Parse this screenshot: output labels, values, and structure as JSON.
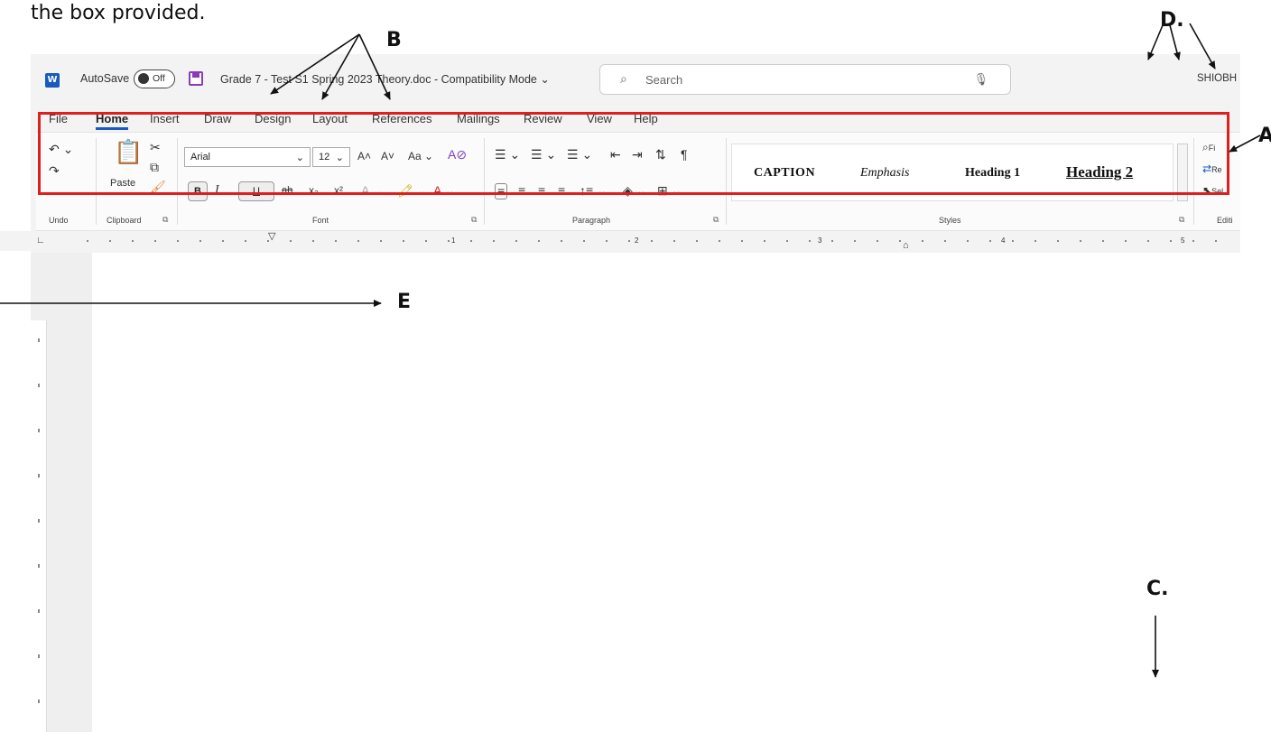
{
  "question_text": "the box provided.",
  "titlebar": {
    "logo": "W",
    "autosave_label": "AutoSave",
    "autosave_state": "Off",
    "document_title": "Grade 7 - Test S1 Spring 2023 Theory.doc - Compatibility Mode ⌄",
    "search_placeholder": "Search",
    "user": "SHIOBH"
  },
  "tabs": [
    "File",
    "Home",
    "Insert",
    "Draw",
    "Design",
    "Layout",
    "References",
    "Mailings",
    "Review",
    "View",
    "Help"
  ],
  "active_tab": "Home",
  "ribbon": {
    "groups": {
      "undo": "Undo",
      "clipboard": "Clipboard",
      "font": "Font",
      "paragraph": "Paragraph",
      "styles": "Styles",
      "editing": "Editi"
    },
    "paste_label": "Paste",
    "font_name": "Arial",
    "font_size": "12",
    "grow_font": "A˄",
    "shrink_font": "A˅",
    "change_case": "Aa ⌄",
    "bold": "B",
    "italic": "I",
    "underline": "U",
    "strike": "ab",
    "subscript": "x₂",
    "superscript": "x²",
    "styles": [
      "CAPTION",
      "Emphasis",
      "Heading 1",
      "Heading 2"
    ],
    "editing_items": [
      "Fi",
      "Re",
      "Sel"
    ]
  },
  "ruler_numbers": [
    "1",
    "2",
    "3",
    "4",
    "5"
  ],
  "annotations": {
    "a": "A",
    "b": "B",
    "c": "C.",
    "d": "D.",
    "e": "E"
  }
}
